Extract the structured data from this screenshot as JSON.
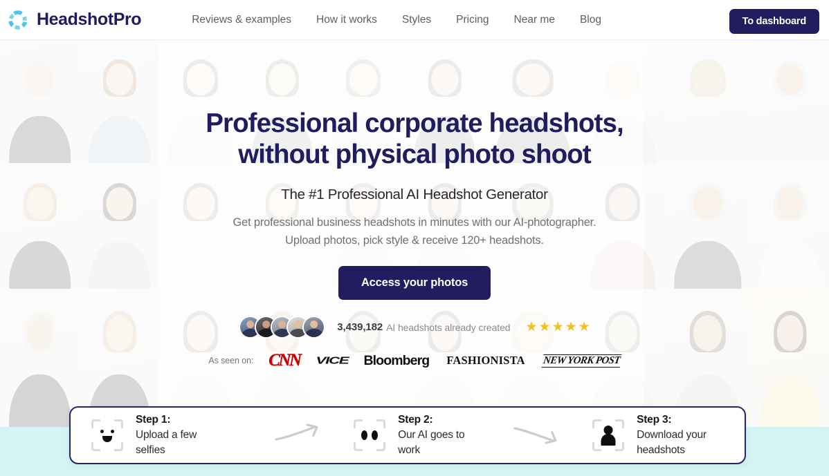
{
  "header": {
    "brand_name": "HeadshotPro",
    "logo_icon": "petal-circle-logo",
    "logo_color": "#4cc3e8",
    "nav": [
      {
        "label": "Reviews & examples"
      },
      {
        "label": "How it works"
      },
      {
        "label": "Styles"
      },
      {
        "label": "Pricing"
      },
      {
        "label": "Near me"
      },
      {
        "label": "Blog"
      }
    ],
    "dashboard_button": "To dashboard",
    "dashboard_button_color": "#231c5e"
  },
  "hero": {
    "title_line1": "Professional corporate headshots,",
    "title_line2": "without physical photo shoot",
    "title_color": "#201c60",
    "subtitle": "The #1 Professional AI Headshot Generator",
    "description": "Get professional business headshots in minutes with our AI-photographer. Upload photos, pick style & receive 120+ headshots.",
    "cta_label": "Access your photos",
    "cta_color": "#231c5e"
  },
  "social_proof": {
    "avatar_count": 5,
    "count": "3,439,182",
    "count_label": "AI headshots already created",
    "stars": 5,
    "star_glyph": "★",
    "star_color": "#f2bf1f"
  },
  "press": {
    "label": "As seen on:",
    "logos": [
      {
        "name": "CNN",
        "class": "logo-cnn",
        "color": "#cc0000"
      },
      {
        "name": "VICE",
        "class": "logo-vice",
        "color": "#111111"
      },
      {
        "name": "Bloomberg",
        "class": "logo-bloomberg",
        "color": "#111111"
      },
      {
        "name": "FASHIONISTA",
        "class": "logo-fashionista",
        "color": "#111111"
      },
      {
        "name": "NEW YORK POST",
        "class": "logo-nypost",
        "color": "#111111"
      }
    ]
  },
  "steps": [
    {
      "label": "Step 1:",
      "desc": "Upload a few selfies",
      "icon": "face-scan-smile-icon"
    },
    {
      "label": "Step 2:",
      "desc": "Our AI goes to work",
      "icon": "face-scan-blobs-icon"
    },
    {
      "label": "Step 3:",
      "desc": "Download your headshots",
      "icon": "face-scan-person-icon"
    }
  ],
  "steps_card": {
    "border_color": "#2a2364",
    "arrow_icon": "curved-arrow-right-icon"
  },
  "background": {
    "teal_strip_color": "#d3f3f4",
    "photo_grid_rows": 3,
    "photo_grid_columns": 10,
    "overlay": "white-fade"
  }
}
